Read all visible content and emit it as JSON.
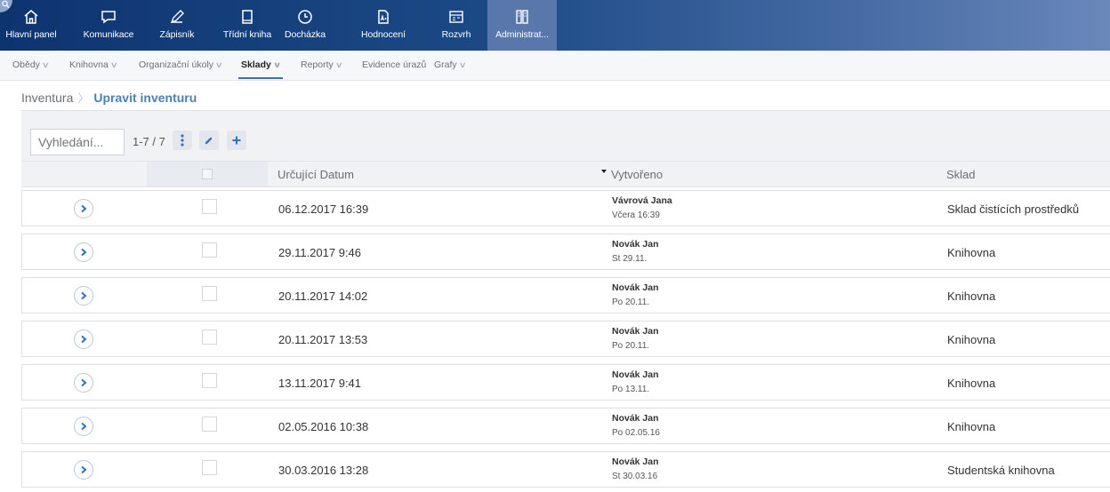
{
  "nav": {
    "items": [
      {
        "label": "Hlavní panel",
        "icon": "home-icon"
      },
      {
        "label": "Komunikace",
        "icon": "chat-icon"
      },
      {
        "label": "Zápisník",
        "icon": "pencil-icon"
      },
      {
        "label": "Třídní kniha",
        "icon": "book-icon"
      },
      {
        "label": "Docházka",
        "icon": "clock-icon"
      },
      {
        "label": "Hodnocení",
        "icon": "grade-icon"
      },
      {
        "label": "Rozvrh",
        "icon": "schedule-icon"
      },
      {
        "label": "Administrat...",
        "icon": "admin-icon"
      }
    ]
  },
  "subnav": {
    "items": [
      {
        "label": "Obědy"
      },
      {
        "label": "Knihovna"
      },
      {
        "label": "Organizační úkoly"
      },
      {
        "label": "Sklady"
      },
      {
        "label": "Reporty"
      },
      {
        "label": "Evidence úrazů"
      },
      {
        "label": "Grafy"
      }
    ]
  },
  "breadcrumb": {
    "parent": "Inventura",
    "current": "Upravit inventuru"
  },
  "toolbar": {
    "search_placeholder": "Vyhledání...",
    "counter": "1-7 / 7"
  },
  "table": {
    "columns": {
      "date": "Určující Datum",
      "created": "Vytvořeno",
      "store": "Sklad"
    },
    "rows": [
      {
        "date": "06.12.2017 16:39",
        "creator": "Vávrová Jana",
        "when": "Včera 16:39",
        "store": "Sklad čistících prostředků"
      },
      {
        "date": "29.11.2017 9:46",
        "creator": "Novák Jan",
        "when": "St 29.11.",
        "store": "Knihovna"
      },
      {
        "date": "20.11.2017 14:02",
        "creator": "Novák Jan",
        "when": "Po 20.11.",
        "store": "Knihovna"
      },
      {
        "date": "20.11.2017 13:53",
        "creator": "Novák Jan",
        "when": "Po 20.11.",
        "store": "Knihovna"
      },
      {
        "date": "13.11.2017 9:41",
        "creator": "Novák Jan",
        "when": "Po 13.11.",
        "store": "Knihovna"
      },
      {
        "date": "02.05.2016 10:38",
        "creator": "Novák Jan",
        "when": "Po 02.05.16",
        "store": "Knihovna"
      },
      {
        "date": "30.03.2016 13:28",
        "creator": "Novák Jan",
        "when": "St 30.03.16",
        "store": "Studentská knihovna"
      }
    ]
  },
  "colors": {
    "accent": "#2f71c4",
    "nav_dark": "#0e3470",
    "breadcrumb_current": "#4b7fb8"
  }
}
